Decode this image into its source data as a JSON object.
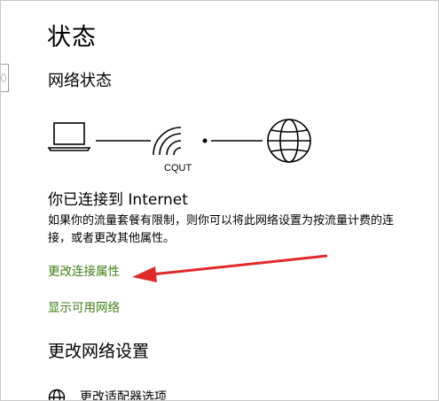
{
  "page": {
    "title": "状态",
    "network_status_heading": "网络状态"
  },
  "network": {
    "ssid": "CQUT",
    "connected_heading": "你已连接到 Internet",
    "description": "如果你的流量套餐有限制，则你可以将此网络设置为按流量计费的连接，或者更改其他属性。"
  },
  "links": {
    "change_properties": "更改连接属性",
    "show_networks": "显示可用网络"
  },
  "change_settings": {
    "heading": "更改网络设置",
    "adapter_options": "更改适配器选项"
  },
  "colors": {
    "link": "#3b7e13",
    "annotation_arrow": "#e02a2a"
  }
}
